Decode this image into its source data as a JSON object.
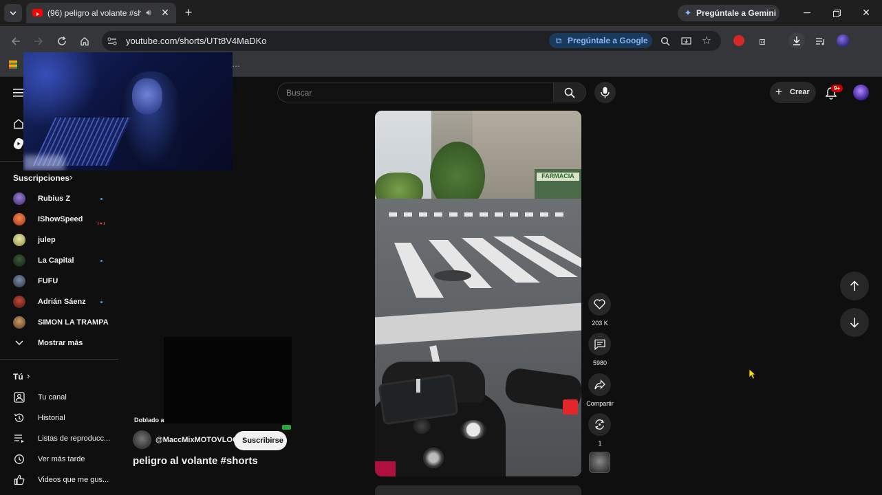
{
  "browser": {
    "tab_title": "(96) peligro al volante #sho",
    "url": "youtube.com/shorts/UTt8V4MaDKo",
    "gemini_label": "Pregúntale a Gemini",
    "google_lens_label": "Pregúntale a Google"
  },
  "header": {
    "search_placeholder": "Buscar",
    "create_label": "Crear",
    "notification_badge": "9+"
  },
  "sidebar": {
    "subscriptions_heading": "Suscripciones",
    "subscriptions": [
      {
        "label": "Rubius Z",
        "live": true
      },
      {
        "label": "IShowSpeed",
        "live": true
      },
      {
        "label": "julep",
        "live": false
      },
      {
        "label": "La Capital",
        "live": true
      },
      {
        "label": "FUFU",
        "live": false
      },
      {
        "label": "Adrián Sáenz",
        "live": true
      },
      {
        "label": "SIMON LA TRAMPA",
        "live": false
      }
    ],
    "show_more": "Mostrar más",
    "you_heading": "Tú",
    "you_items": [
      "Tu canal",
      "Historial",
      "Listas de reproducc...",
      "Ver más tarde",
      "Videos que me gus..."
    ]
  },
  "short": {
    "dubbed_label": "Doblado a",
    "channel": "@MaccMixMOTOVLOG",
    "subscribe_label": "Suscribirse",
    "title": "peligro al volante #shorts",
    "likes": "203 K",
    "comments": "5980",
    "share_label": "Compartir",
    "remix_count": "1"
  },
  "colors": {
    "accent_blue": "#3ea6ff",
    "notification_red": "#cc0000",
    "background": "#0f0f0f"
  }
}
